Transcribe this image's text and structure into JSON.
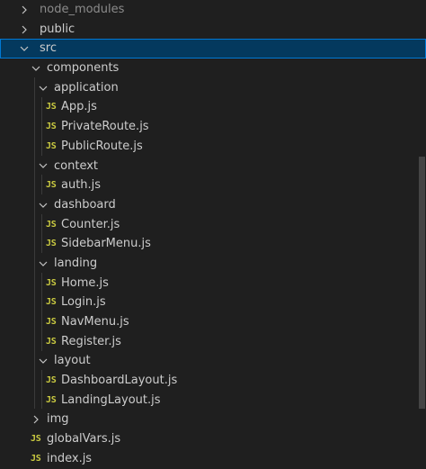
{
  "explorer": {
    "items": [
      {
        "label": "node_modules",
        "type": "folder",
        "expanded": false
      },
      {
        "label": "public",
        "type": "folder",
        "expanded": false
      },
      {
        "label": "src",
        "type": "folder",
        "expanded": true,
        "selected": true
      },
      {
        "label": "components",
        "type": "folder",
        "expanded": true
      },
      {
        "label": "application",
        "type": "folder",
        "expanded": true
      },
      {
        "label": "App.js",
        "type": "file",
        "icon": "JS"
      },
      {
        "label": "PrivateRoute.js",
        "type": "file",
        "icon": "JS"
      },
      {
        "label": "PublicRoute.js",
        "type": "file",
        "icon": "JS"
      },
      {
        "label": "context",
        "type": "folder",
        "expanded": true
      },
      {
        "label": "auth.js",
        "type": "file",
        "icon": "JS"
      },
      {
        "label": "dashboard",
        "type": "folder",
        "expanded": true
      },
      {
        "label": "Counter.js",
        "type": "file",
        "icon": "JS"
      },
      {
        "label": "SidebarMenu.js",
        "type": "file",
        "icon": "JS"
      },
      {
        "label": "landing",
        "type": "folder",
        "expanded": true
      },
      {
        "label": "Home.js",
        "type": "file",
        "icon": "JS"
      },
      {
        "label": "Login.js",
        "type": "file",
        "icon": "JS"
      },
      {
        "label": "NavMenu.js",
        "type": "file",
        "icon": "JS"
      },
      {
        "label": "Register.js",
        "type": "file",
        "icon": "JS"
      },
      {
        "label": "layout",
        "type": "folder",
        "expanded": true
      },
      {
        "label": "DashboardLayout.js",
        "type": "file",
        "icon": "JS"
      },
      {
        "label": "LandingLayout.js",
        "type": "file",
        "icon": "JS"
      },
      {
        "label": "img",
        "type": "folder",
        "expanded": false
      },
      {
        "label": "globalVars.js",
        "type": "file",
        "icon": "JS"
      },
      {
        "label": "index.js",
        "type": "file",
        "icon": "JS"
      }
    ]
  },
  "colors": {
    "background": "#1f1f1f",
    "selection": "#04395e",
    "focus_border": "#0078d4",
    "js_icon": "#cbcb41",
    "text": "#cccccc"
  }
}
